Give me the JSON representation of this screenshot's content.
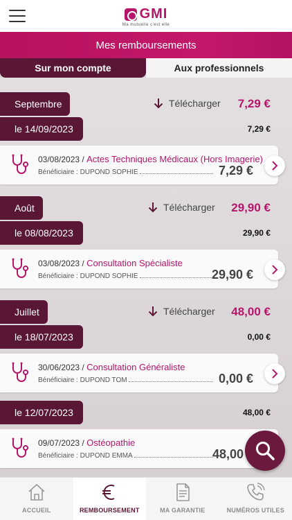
{
  "header": {
    "brand": "GMI",
    "tagline": "Ma mutuelle c'est elle",
    "menu_icon": "hamburger-icon"
  },
  "title": "Mes remboursements",
  "tabs": [
    {
      "label": "Sur mon compte",
      "active": true
    },
    {
      "label": "Aux professionnels",
      "active": false
    }
  ],
  "groups": [
    {
      "month": "Septembre",
      "download_label": "Télécharger",
      "total": "7,29 €",
      "dates": [
        {
          "date": "le 14/09/2023",
          "total": "7,29 €",
          "items": [
            {
              "date": "03/08/2023",
              "separator": "/",
              "act": "Actes Techniques Médicaux (Hors Imagerie)",
              "beneficiary": "Bénéficiaire : DUPOND SOPHIE",
              "amount": "7,29 €"
            }
          ]
        }
      ]
    },
    {
      "month": "Août",
      "download_label": "Télécharger",
      "total": "29,90 €",
      "dates": [
        {
          "date": "le 08/08/2023",
          "total": "29,90 €",
          "items": [
            {
              "date": "03/08/2023",
              "separator": "/",
              "act": "Consultation Spécialiste",
              "beneficiary": "Bénéficiaire : DUPOND SOPHIE",
              "amount": "29,90 €"
            }
          ]
        }
      ]
    },
    {
      "month": "Juillet",
      "download_label": "Télécharger",
      "total": "48,00 €",
      "dates": [
        {
          "date": "le 18/07/2023",
          "total": "0,00 €",
          "items": [
            {
              "date": "30/06/2023",
              "separator": "/",
              "act": "Consultation Généraliste",
              "beneficiary": "Bénéficiaire : DUPOND TOM",
              "amount": "0,00 €"
            }
          ]
        },
        {
          "date": "le 12/07/2023",
          "total": "48,00 €",
          "items": [
            {
              "date": "09/07/2023",
              "separator": "/",
              "act": "Ostéopathie",
              "beneficiary": "Bénéficiaire : DUPOND EMMA",
              "amount": "48,00"
            }
          ]
        }
      ]
    }
  ],
  "nav": [
    {
      "label": "ACCUEIL",
      "icon": "home-icon",
      "active": false
    },
    {
      "label": "REMBOURSEMENT",
      "icon": "euro-icon",
      "active": true
    },
    {
      "label": "MA GARANTIE",
      "icon": "document-icon",
      "active": false
    },
    {
      "label": "NUMÉROS UTILES",
      "icon": "phone-icon",
      "active": false
    }
  ],
  "colors": {
    "brand": "#b5156a",
    "dark": "#5a1735",
    "fab": "#6b1a3d"
  }
}
